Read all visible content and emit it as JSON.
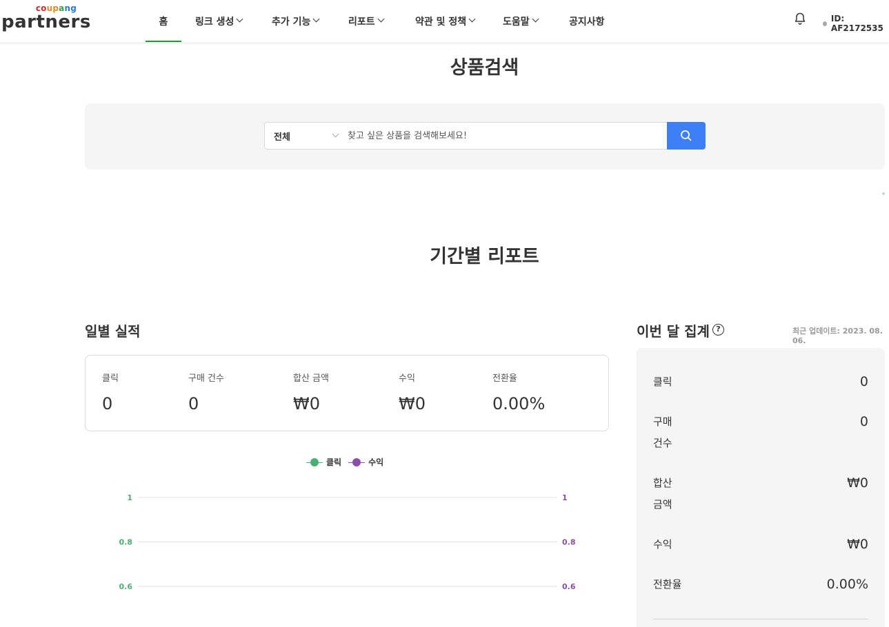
{
  "header": {
    "logo_top": "coupang",
    "logo_main": "partners",
    "nav": [
      {
        "label": "홈",
        "active": true,
        "dropdown": false
      },
      {
        "label": "링크 생성",
        "active": false,
        "dropdown": true
      },
      {
        "label": "추가 기능",
        "active": false,
        "dropdown": true
      },
      {
        "label": "리포트",
        "active": false,
        "dropdown": true
      },
      {
        "label": "약관 및 정책",
        "active": false,
        "dropdown": true
      },
      {
        "label": "도움말",
        "active": false,
        "dropdown": true
      },
      {
        "label": "공지사항",
        "active": false,
        "dropdown": false
      }
    ],
    "user_id": "ID: AF2172535"
  },
  "search": {
    "title": "상품검색",
    "category": "전체",
    "placeholder": "찾고 싶은 상품을 검색해보세요!"
  },
  "report": {
    "title": "기간별 리포트",
    "daily": {
      "title": "일별 실적",
      "stats": [
        {
          "label": "클릭",
          "value": "0"
        },
        {
          "label": "구매 건수",
          "value": "0"
        },
        {
          "label": "합산 금액",
          "value": "₩0"
        },
        {
          "label": "수익",
          "value": "₩0"
        },
        {
          "label": "전환율",
          "value": "0.00%"
        }
      ]
    },
    "monthly": {
      "title": "이번 달 집계",
      "help": "?",
      "update": "최근 업데이트: 2023. 08. 06.",
      "rows": [
        {
          "label": "클릭",
          "value": "0"
        },
        {
          "label": "구매\n건수",
          "value": "0"
        },
        {
          "label": "합산\n금액",
          "value": "₩0"
        },
        {
          "label": "수익",
          "value": "₩0"
        },
        {
          "label": "전환율",
          "value": "0.00%"
        }
      ]
    }
  },
  "chart_data": {
    "type": "line",
    "legend": [
      "클릭",
      "수익"
    ],
    "series": [
      {
        "name": "클릭",
        "color": "#4cae76",
        "values": []
      },
      {
        "name": "수익",
        "color": "#8a4fa8",
        "values": []
      }
    ],
    "y_left_ticks": [
      "1",
      "0.8",
      "0.6"
    ],
    "y_right_ticks": [
      "1",
      "0.8",
      "0.6"
    ],
    "ylim": [
      0,
      1
    ],
    "grid": true
  },
  "colors": {
    "active_nav": "#1a9b36",
    "search_button": "#3d7ff7",
    "click_series": "#4cae76",
    "revenue_series": "#8a4fa8"
  }
}
